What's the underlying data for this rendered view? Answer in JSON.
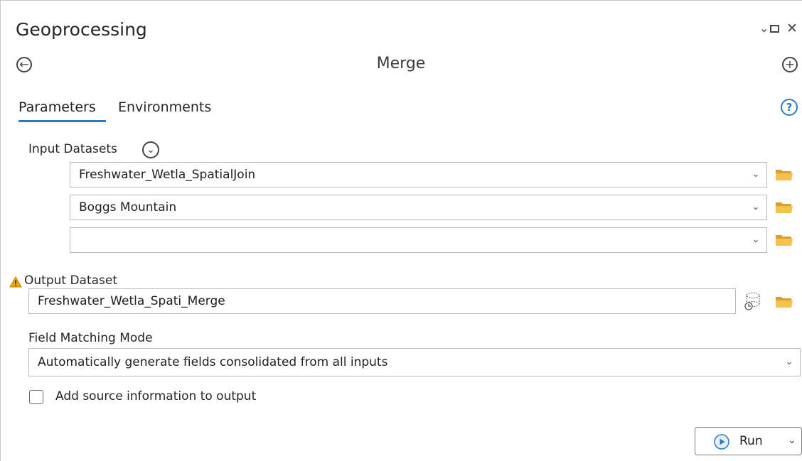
{
  "window": {
    "title": "Geoprocessing",
    "controls": {
      "dropdown": "⌄",
      "maximize": "□",
      "close": "✕"
    }
  },
  "tool": {
    "name": "Merge",
    "back_icon": "back-arrow-icon",
    "add_icon": "plus-circle-icon"
  },
  "tabs": [
    {
      "label": "Parameters",
      "active": true
    },
    {
      "label": "Environments",
      "active": false
    }
  ],
  "help_glyph": "?",
  "input_datasets": {
    "label": "Input Datasets",
    "items": [
      {
        "value": "Freshwater_Wetla_SpatialJoin"
      },
      {
        "value": "Boggs Mountain"
      },
      {
        "value": ""
      }
    ]
  },
  "output_dataset": {
    "label": "Output Dataset",
    "value": "Freshwater_Wetla_Spati_Merge",
    "warning": true
  },
  "field_matching": {
    "label": "Field Matching Mode",
    "value": "Automatically generate fields consolidated from all inputs"
  },
  "add_source": {
    "label": "Add source information to output",
    "checked": false
  },
  "run_button": {
    "label": "Run"
  },
  "colors": {
    "accent": "#2d7bc4",
    "folder": "#e8b43a",
    "warning": "#f0a30a"
  }
}
